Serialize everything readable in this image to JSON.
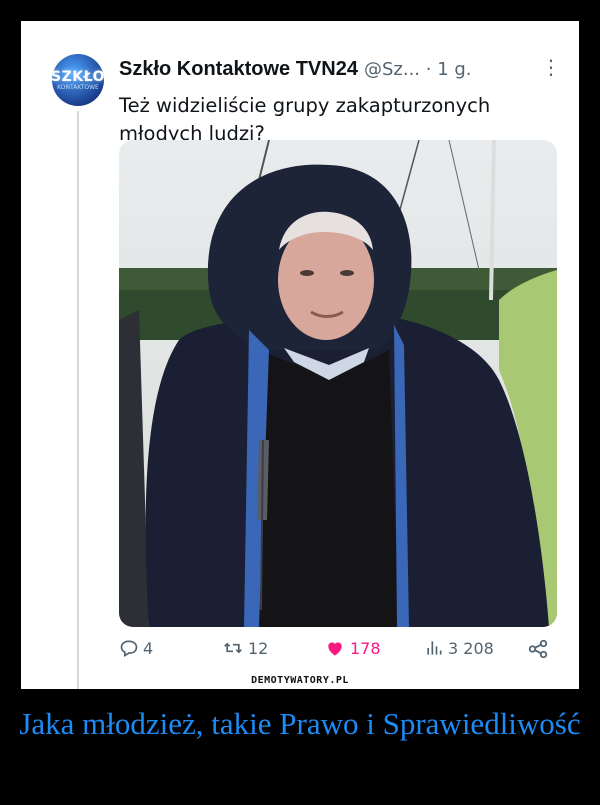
{
  "post": {
    "author_name": "Szkło Kontaktowe TVN24",
    "handle": "@Sz...",
    "time": " · 1 g.",
    "text": "Też widzieliście grupy zakapturzonych młodych ludzi?",
    "avatar_text_main": "SZKŁO",
    "avatar_text_sub": "KONTAKTOWE"
  },
  "actions": {
    "replies": "4",
    "reposts": "12",
    "likes": "178",
    "views": "3 208"
  },
  "watermark": "DEMOTYWATORY.PL",
  "caption": "Jaka młodzież, takie Prawo i Sprawiedliwość",
  "colors": {
    "like": "#f91880",
    "caption": "#1d8bf5",
    "muted": "#536471"
  }
}
